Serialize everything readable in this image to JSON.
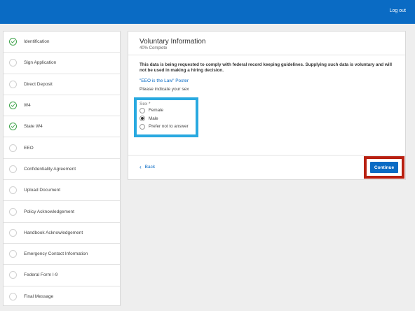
{
  "header": {
    "logout_label": "Log out"
  },
  "sidebar": {
    "items": [
      {
        "label": "Identification",
        "completed": true
      },
      {
        "label": "Sign Application",
        "completed": false
      },
      {
        "label": "Direct Deposit",
        "completed": false
      },
      {
        "label": "W4",
        "completed": true
      },
      {
        "label": "State W4",
        "completed": true
      },
      {
        "label": "EEO",
        "completed": false
      },
      {
        "label": "Confidentiality Agreement",
        "completed": false
      },
      {
        "label": "Upload Document",
        "completed": false
      },
      {
        "label": "Policy Acknowledgement",
        "completed": false
      },
      {
        "label": "Handbook Acknowledgement",
        "completed": false
      },
      {
        "label": "Emergency Contact Information",
        "completed": false
      },
      {
        "label": "Federal Form I-9",
        "completed": false
      },
      {
        "label": "Final Message",
        "completed": false
      }
    ]
  },
  "form": {
    "title": "Voluntary Information",
    "progress": "40% Complete",
    "notice": "This data is being requested to comply with federal record keeping guidelines. Supplying such data is voluntary and will not be used in making a hiring decision.",
    "poster_link": "\"EEO is the Law\" Poster",
    "prompt": "Please indicate your sex",
    "sex": {
      "legend": "Sex *",
      "options": [
        "Female",
        "Male",
        "Prefer not to answer"
      ],
      "selected": "Male"
    }
  },
  "footer": {
    "back_label": "Back",
    "continue_label": "Continue"
  },
  "colors": {
    "brand": "#0a6bc4",
    "complete": "#3ea34a",
    "highlight_blue": "#29a9e0",
    "highlight_red": "#b82011"
  }
}
